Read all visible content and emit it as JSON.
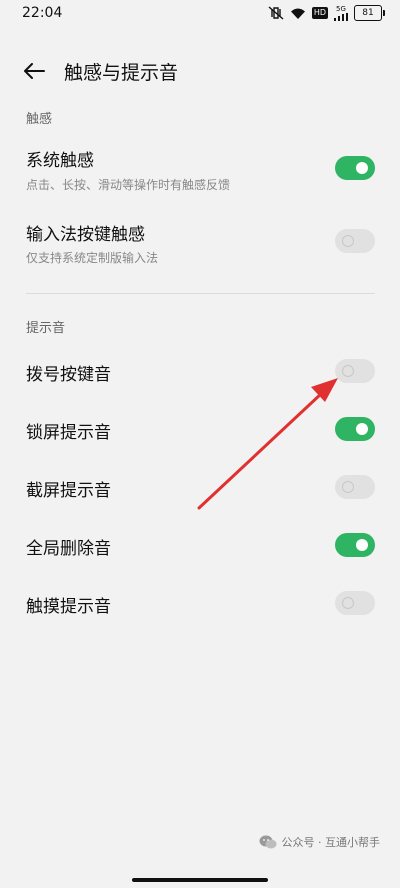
{
  "status_bar": {
    "time": "22:04",
    "hd_badge": "HD",
    "network_badge": "5G",
    "battery": "81"
  },
  "header": {
    "title": "触感与提示音"
  },
  "sections": {
    "haptics": {
      "header": "触感",
      "items": [
        {
          "title": "系统触感",
          "subtitle": "点击、长按、滑动等操作时有触感反馈",
          "on": true
        },
        {
          "title": "输入法按键触感",
          "subtitle": "仅支持系统定制版输入法",
          "on": false
        }
      ]
    },
    "sounds": {
      "header": "提示音",
      "items": [
        {
          "title": "拨号按键音",
          "on": false
        },
        {
          "title": "锁屏提示音",
          "on": true
        },
        {
          "title": "截屏提示音",
          "on": false
        },
        {
          "title": "全局删除音",
          "on": true
        },
        {
          "title": "触摸提示音",
          "on": false
        }
      ]
    }
  },
  "watermark": {
    "text": "公众号 · 互通小帮手"
  },
  "colors": {
    "toggle_on": "#2fb463",
    "toggle_off": "#e1e1e1",
    "arrow": "#e03030"
  }
}
